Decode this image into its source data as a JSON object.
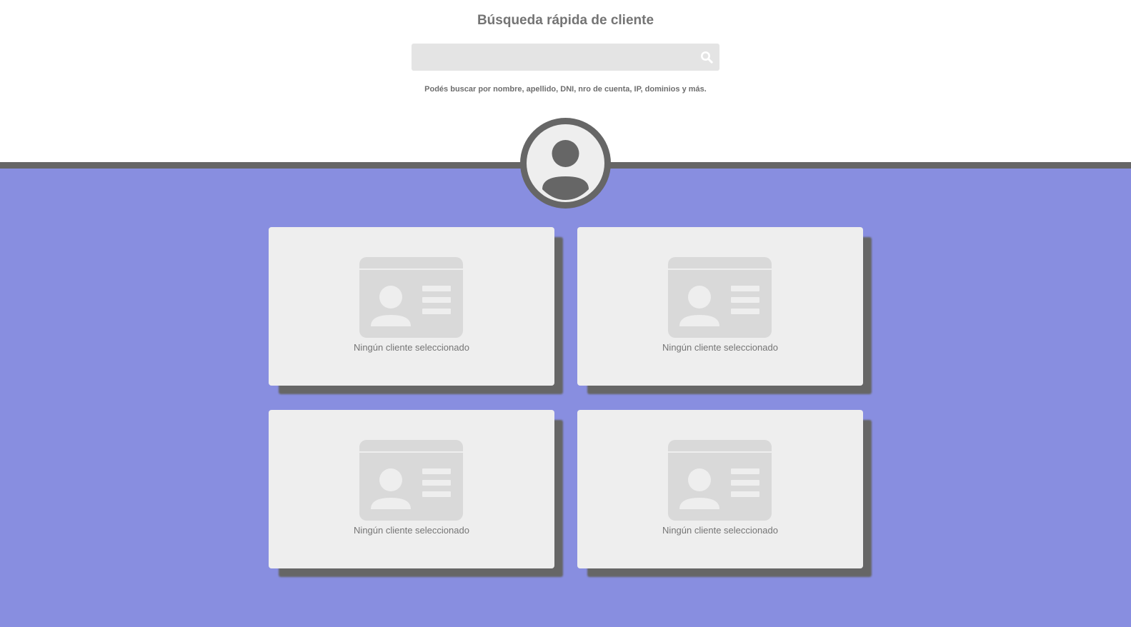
{
  "header": {
    "title": "Búsqueda rápida de cliente",
    "hint": "Podés buscar por nombre, apellido, DNI, nro de cuenta, IP, dominios y más."
  },
  "search": {
    "placeholder": "",
    "value": "",
    "icon": "search-icon"
  },
  "avatar": {
    "icon": "user-avatar-icon"
  },
  "cards": [
    {
      "label": "Ningún cliente seleccionado",
      "icon": "id-card-icon"
    },
    {
      "label": "Ningún cliente seleccionado",
      "icon": "id-card-icon"
    },
    {
      "label": "Ningún cliente seleccionado",
      "icon": "id-card-icon"
    },
    {
      "label": "Ningún cliente seleccionado",
      "icon": "id-card-icon"
    }
  ],
  "colors": {
    "background_bottom": "#888ee0",
    "divider": "#666666",
    "card": "#eeeeee",
    "card_shadow": "#666666",
    "search_box": "#e4e4e4",
    "title_text": "#747474"
  }
}
